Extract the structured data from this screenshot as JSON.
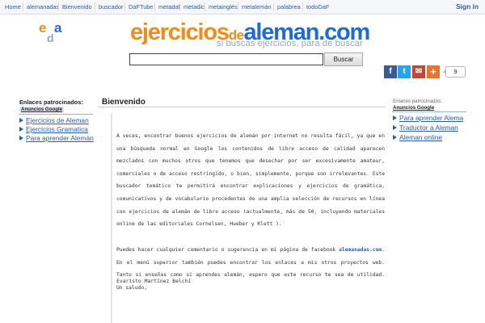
{
  "nav": {
    "items": [
      {
        "label": "Home"
      },
      {
        "label": "alemanadas"
      },
      {
        "label": "Bienvenido"
      },
      {
        "label": "buscador"
      },
      {
        "label": "DaFTube"
      },
      {
        "label": "metadaf"
      },
      {
        "label": "metadic"
      },
      {
        "label": "metainglés"
      },
      {
        "label": "metalemán"
      },
      {
        "label": "palabrea"
      },
      {
        "label": "todoDaF"
      }
    ],
    "signin": "Sign in"
  },
  "logo": {
    "small_icon": "eda-logo",
    "part1": "ejercicios",
    "part2": "de",
    "part3": "aleman.com",
    "tagline": "si buscas ejercicios, para de buscar"
  },
  "search": {
    "value": "",
    "button": "Buscar"
  },
  "share": {
    "facebook": "f",
    "twitter": "t",
    "mail": "✉",
    "more": "+",
    "count": "9"
  },
  "left_sidebar": {
    "title": "Enlaces patrocinados:",
    "ads_label": "Anuncios Google",
    "links": [
      {
        "label": "Ejercicios de Aleman"
      },
      {
        "label": "Ejercicios Gramatica"
      },
      {
        "label": "Para aprender Alemán"
      }
    ]
  },
  "main": {
    "title": "Bienvenido",
    "paragraph1": "A veces, encontrar buenos ejercicios de alemán por internet no resulta fácil, ya que en una búsqueda normal en Google los contenidos de libre acceso de calidad aparecen mezclados con muchos otros que  tenemos que desechar por ser excesivamente amateur, comerciales o de acceso restringido, o bien, simplemente, porque son irrelevantes. Este buscador temático te permitirá encontrar explicaciones y ejercicios de gramática, comunicativos y de vocabulario procedentes de una amplia selección de recursos en línea con ejercicios de alemán de libre acceso (actualmente, más de 50, incluyendo materiales online de las editoriales Cornelsen, Hueber y Klett ).",
    "paragraph2_before": "Puedes hacer cualquier comentario o sugerencia en mi página de facebook ",
    "paragraph2_link": "alemanadas.com",
    "paragraph2_after": ". En el menú superior también puedes encontrar los enlaces a mis otros proyectos web. Tanto si enseñas como si aprendes alemán, espero que este recurso te sea de utilidad. Un saludo,",
    "signature": "Evaristo Martínez Belchí"
  },
  "right_sidebar": {
    "title": "Enlaces patrocinados:",
    "ads_label": "Anuncios Google",
    "links": [
      {
        "label": "Para aprender Alema"
      },
      {
        "label": "Traductor a Aleman"
      },
      {
        "label": "Aleman online"
      }
    ]
  }
}
